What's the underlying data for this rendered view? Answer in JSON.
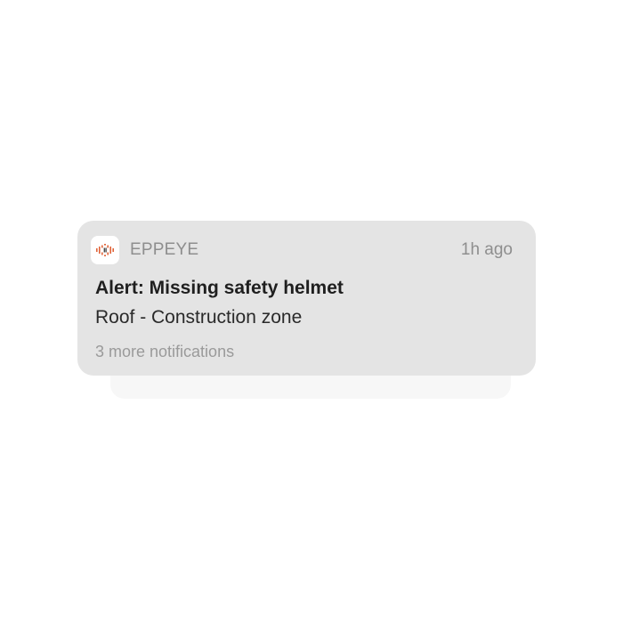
{
  "notification": {
    "app_name": "EPPEYE",
    "time": "1h ago",
    "title": "Alert: Missing safety helmet",
    "body": "Roof - Construction zone",
    "more": "3 more notifications",
    "icon": "eppeye-app-logo"
  },
  "colors": {
    "card_background": "#e4e4e4",
    "logo_accent": "#e0643a",
    "logo_secondary": "#4a4a4a"
  }
}
